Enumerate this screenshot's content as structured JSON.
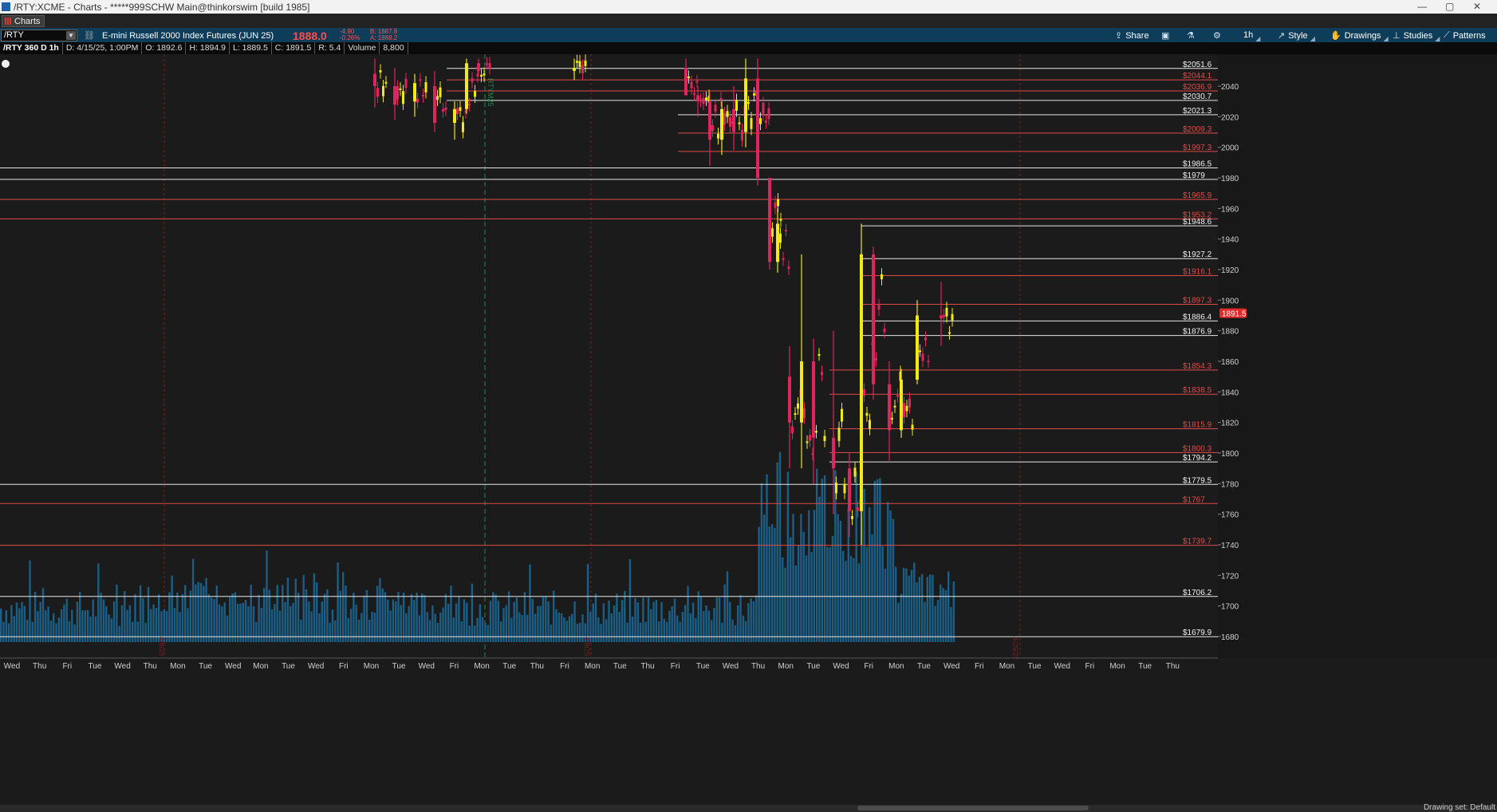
{
  "window": {
    "title": "/RTY:XCME - Charts - *****999SCHW Main@thinkorswim [build 1985]",
    "controls": [
      "—",
      "▢",
      "✕"
    ]
  },
  "tabs": [
    {
      "label": "Charts"
    }
  ],
  "toolbar": {
    "symbol": "/RTY",
    "instrument": "E-mini Russell 2000 Index Futures (JUN 25)",
    "last": "1888.0",
    "net_change": "-4.90",
    "pct_change": "-0.26%",
    "bid": "B: 1887.8",
    "ask": "A: 1888.2",
    "items": [
      {
        "label": "Share",
        "icon": "share-icon"
      },
      {
        "label": "",
        "icon": "notes-icon"
      },
      {
        "label": "",
        "icon": "flask-icon"
      },
      {
        "label": "",
        "icon": "gear-icon"
      },
      {
        "label": "1h",
        "icon": ""
      },
      {
        "label": "Style",
        "icon": "style-icon"
      },
      {
        "label": "Drawings",
        "icon": "drawings-icon"
      },
      {
        "label": "Studies",
        "icon": "studies-icon"
      },
      {
        "label": "Patterns",
        "icon": "patterns-icon"
      }
    ]
  },
  "infobar": {
    "aggregation": "/RTY 360 D 1h",
    "date": "D: 4/15/25, 1:00PM",
    "open": "O: 1892.6",
    "high": "H: 1894.9",
    "low": "L: 1889.5",
    "close": "C: 1891.5",
    "range": "R: 5.4",
    "volume_label": "Volume",
    "volume_value": "8,800"
  },
  "colors": {
    "background": "#1b1b1b",
    "toolbar": "#0e3d5a",
    "down": "#e0245e",
    "up": "#f2ea12",
    "volume": "#1b5f86",
    "red_level": "#e04a4a",
    "white_level": "#e6e6e6",
    "price_tag": "#e02a2a"
  },
  "status": {
    "text": "Drawing set: Default"
  },
  "chart_data": {
    "type": "candlestick",
    "symbol": "/RTY",
    "timeframe": "1h",
    "ylim": [
      1670,
      2058
    ],
    "y_ticks": [
      1680,
      1700,
      1720,
      1740,
      1760,
      1780,
      1800,
      1820,
      1840,
      1860,
      1880,
      1900,
      1920,
      1940,
      1960,
      1980,
      2000,
      2020,
      2040
    ],
    "current_price": "1891.5",
    "x_labels": [
      "Wed",
      "Thu",
      "Fri",
      "Tue",
      "Wed",
      "Thu",
      "Mon",
      "Tue",
      "Wed",
      "Mon",
      "Tue",
      "Wed",
      "Fri",
      "Mon",
      "Tue",
      "Wed",
      "Fri",
      "Mon",
      "Tue",
      "Thu",
      "Fri",
      "Mon",
      "Tue",
      "Thu",
      "Fri",
      "Tue",
      "Wed",
      "Thu",
      "Mon",
      "Tue",
      "Wed",
      "Fri",
      "Mon",
      "Tue",
      "Wed",
      "Fri",
      "Mon",
      "Tue",
      "Wed",
      "Fri",
      "Mon",
      "Tue",
      "Thu"
    ],
    "price_levels": [
      {
        "label": "$2051.6",
        "value": 2051.6,
        "color": "white"
      },
      {
        "label": "$2044.1",
        "value": 2044.1,
        "color": "red"
      },
      {
        "label": "$2036.9",
        "value": 2036.9,
        "color": "red"
      },
      {
        "label": "$2030.7",
        "value": 2030.7,
        "color": "white"
      },
      {
        "label": "$2021.3",
        "value": 2021.3,
        "color": "white"
      },
      {
        "label": "$2009.3",
        "value": 2009.3,
        "color": "red"
      },
      {
        "label": "$1997.3",
        "value": 1997.3,
        "color": "red"
      },
      {
        "label": "$1986.5",
        "value": 1986.5,
        "color": "white"
      },
      {
        "label": "$1979",
        "value": 1979,
        "color": "white"
      },
      {
        "label": "$1965.9",
        "value": 1965.9,
        "color": "red"
      },
      {
        "label": "$1953.2",
        "value": 1953.2,
        "color": "red"
      },
      {
        "label": "$1948.6",
        "value": 1948.6,
        "color": "white"
      },
      {
        "label": "$1927.2",
        "value": 1927.2,
        "color": "white"
      },
      {
        "label": "$1916.1",
        "value": 1916.1,
        "color": "red"
      },
      {
        "label": "$1897.3",
        "value": 1897.3,
        "color": "red"
      },
      {
        "label": "$1886.4",
        "value": 1886.4,
        "color": "white"
      },
      {
        "label": "$1876.9",
        "value": 1876.9,
        "color": "white"
      },
      {
        "label": "$1854.3",
        "value": 1854.3,
        "color": "red"
      },
      {
        "label": "$1838.5",
        "value": 1838.5,
        "color": "red"
      },
      {
        "label": "$1815.9",
        "value": 1815.9,
        "color": "red"
      },
      {
        "label": "$1800.3",
        "value": 1800.3,
        "color": "red"
      },
      {
        "label": "$1794.2",
        "value": 1794.2,
        "color": "white"
      },
      {
        "label": "$1779.5",
        "value": 1779.5,
        "color": "white"
      },
      {
        "label": "$1767",
        "value": 1767,
        "color": "red"
      },
      {
        "label": "$1739.7",
        "value": 1739.7,
        "color": "red"
      },
      {
        "label": "$1706.2",
        "value": 1706.2,
        "color": "white"
      },
      {
        "label": "$1679.9",
        "value": 1679.9,
        "color": "white"
      }
    ],
    "expiration_markers": [
      {
        "label": "RTYM25"
      },
      {
        "label": "4/9/25"
      },
      {
        "label": "4/9/25"
      },
      {
        "label": "4/29/25"
      }
    ],
    "candles_ohlc_by_segment": [
      {
        "o": 2048,
        "h": 2058,
        "l": 2026,
        "c": 2040
      },
      {
        "o": 2040,
        "h": 2052,
        "l": 2018,
        "c": 2028
      },
      {
        "o": 2030,
        "h": 2048,
        "l": 2020,
        "c": 2042
      },
      {
        "o": 2040,
        "h": 2050,
        "l": 2010,
        "c": 2016
      },
      {
        "o": 2016,
        "h": 2030,
        "l": 2005,
        "c": 2025
      },
      {
        "o": 2025,
        "h": 2058,
        "l": 2022,
        "c": 2055
      },
      {
        "o": 2055,
        "h": 2058,
        "l": 2048,
        "c": 2050
      },
      {
        "o": 2050,
        "h": 2058,
        "l": 2044,
        "c": 2052
      },
      {
        "o": 2052,
        "h": 2058,
        "l": 2040,
        "c": 2034
      },
      {
        "o": 2034,
        "h": 2040,
        "l": 2020,
        "c": 2030
      },
      {
        "o": 2030,
        "h": 2036,
        "l": 1988,
        "c": 2005
      },
      {
        "o": 2005,
        "h": 2030,
        "l": 1995,
        "c": 2025
      },
      {
        "o": 2025,
        "h": 2040,
        "l": 1998,
        "c": 2010
      },
      {
        "o": 2010,
        "h": 2058,
        "l": 2000,
        "c": 2045
      },
      {
        "o": 2045,
        "h": 2058,
        "l": 1975,
        "c": 1980
      },
      {
        "o": 1980,
        "h": 1975,
        "l": 1920,
        "c": 1925
      },
      {
        "o": 1925,
        "h": 1960,
        "l": 1918,
        "c": 1950
      },
      {
        "o": 1850,
        "h": 1870,
        "l": 1790,
        "c": 1820
      },
      {
        "o": 1820,
        "h": 1930,
        "l": 1790,
        "c": 1860
      },
      {
        "o": 1860,
        "h": 1875,
        "l": 1780,
        "c": 1810
      },
      {
        "o": 1810,
        "h": 1880,
        "l": 1760,
        "c": 1790
      },
      {
        "o": 1790,
        "h": 1800,
        "l": 1745,
        "c": 1762
      },
      {
        "o": 1762,
        "h": 1950,
        "l": 1740,
        "c": 1930
      },
      {
        "o": 1930,
        "h": 1935,
        "l": 1835,
        "c": 1845
      },
      {
        "o": 1845,
        "h": 1860,
        "l": 1795,
        "c": 1815
      },
      {
        "o": 1815,
        "h": 1855,
        "l": 1810,
        "c": 1848
      },
      {
        "o": 1848,
        "h": 1900,
        "l": 1845,
        "c": 1890
      },
      {
        "o": 1890,
        "h": 1912,
        "l": 1870,
        "c": 1888
      }
    ]
  }
}
